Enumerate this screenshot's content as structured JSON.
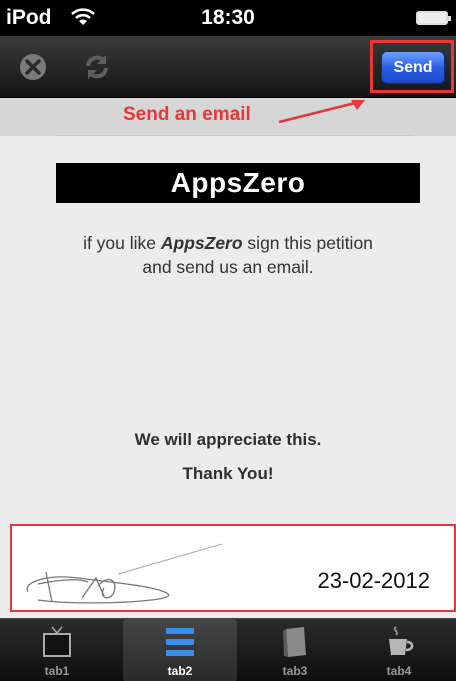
{
  "status_bar": {
    "carrier": "iPod",
    "time": "18:30"
  },
  "toolbar": {
    "send_label": "Send"
  },
  "annotation": {
    "text": "Send an email"
  },
  "logo": {
    "text": "AppsZero"
  },
  "message": {
    "prefix": "if you like ",
    "brand": "AppsZero",
    "suffix": " sign this petition",
    "line2": "and send us an email."
  },
  "appreciation": "We will appreciate this.",
  "thanks": "Thank You!",
  "signature": {
    "date": "23-02-2012"
  },
  "tabs": [
    {
      "label": "tab1",
      "icon": "tv-icon"
    },
    {
      "label": "tab2",
      "icon": "list-icon"
    },
    {
      "label": "tab3",
      "icon": "book-icon"
    },
    {
      "label": "tab4",
      "icon": "coffee-cup-icon"
    }
  ],
  "active_tab": "tab2",
  "colors": {
    "highlight_red": "#e8363a",
    "send_blue": "#2a5fe6",
    "active_tab_blue": "#3a8fe8"
  }
}
